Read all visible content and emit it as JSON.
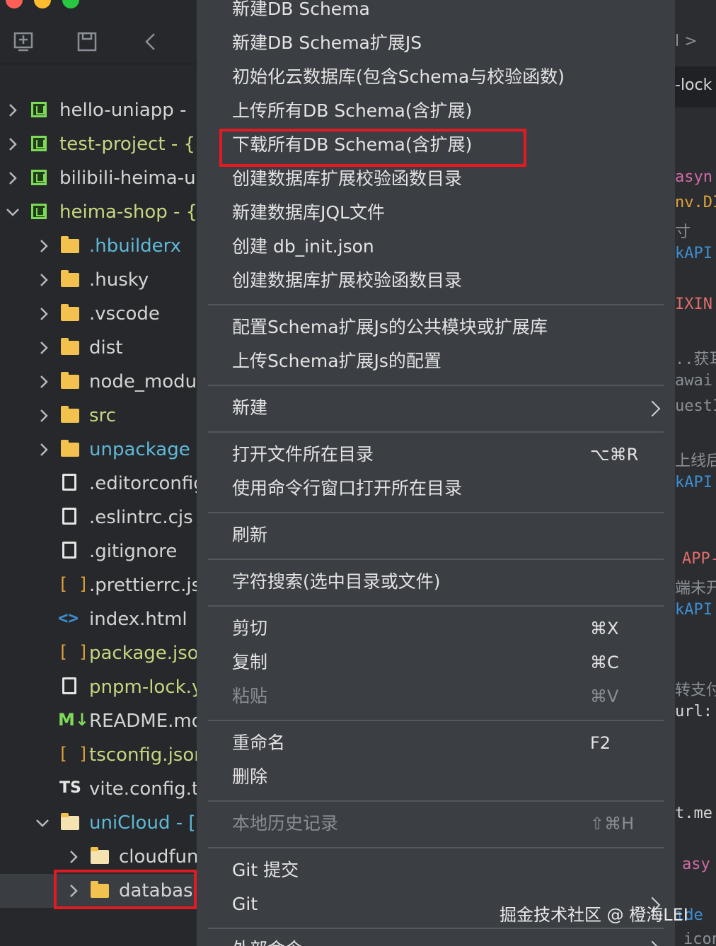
{
  "sidebar": {
    "tree": [
      {
        "label": "hello-uniapp - ",
        "type": "project"
      },
      {
        "label": "test-project - {",
        "type": "project"
      },
      {
        "label": "bilibili-heima-u",
        "type": "project"
      },
      {
        "label": "heima-shop - {",
        "type": "project"
      },
      {
        "label": ".hbuilderx",
        "type": "folder"
      },
      {
        "label": ".husky",
        "type": "folder"
      },
      {
        "label": ".vscode",
        "type": "folder"
      },
      {
        "label": "dist",
        "type": "folder"
      },
      {
        "label": "node_modul",
        "type": "folder"
      },
      {
        "label": "src",
        "type": "folder"
      },
      {
        "label": "unpackage",
        "type": "folder"
      },
      {
        "label": ".editorconfig",
        "type": "file"
      },
      {
        "label": ".eslintrc.cjs",
        "type": "file"
      },
      {
        "label": ".gitignore",
        "type": "file"
      },
      {
        "label": ".prettierrc.js",
        "type": "json"
      },
      {
        "label": "index.html",
        "type": "html"
      },
      {
        "label": "package.jso",
        "type": "json"
      },
      {
        "label": "pnpm-lock.y",
        "type": "file"
      },
      {
        "label": "README.md",
        "type": "markdown"
      },
      {
        "label": "tsconfig.json",
        "type": "json"
      },
      {
        "label": "vite.config.t",
        "type": "typescript"
      },
      {
        "label": "uniCloud - [",
        "type": "folder-open"
      },
      {
        "label": "cloudfun",
        "type": "folder"
      },
      {
        "label": "database",
        "type": "folder"
      }
    ],
    "icons": {
      "md": "M↓",
      "ts": "TS",
      "json": "[ ]",
      "html": "<>"
    }
  },
  "context_menu": {
    "groups": [
      [
        {
          "label": "新建DB Schema"
        },
        {
          "label": "新建DB Schema扩展JS"
        },
        {
          "label": "初始化云数据库(包含Schema与校验函数)"
        },
        {
          "label": "上传所有DB Schema(含扩展)"
        },
        {
          "label": "下载所有DB Schema(含扩展)",
          "highlighted": true
        },
        {
          "label": "创建数据库扩展校验函数目录"
        },
        {
          "label": "新建数据库JQL文件"
        },
        {
          "label": "创建 db_init.json"
        },
        {
          "label": "创建数据库扩展校验函数目录"
        }
      ],
      [
        {
          "label": "配置Schema扩展Js的公共模块或扩展库"
        },
        {
          "label": "上传Schema扩展Js的配置"
        }
      ],
      [
        {
          "label": "新建",
          "submenu": true
        }
      ],
      [
        {
          "label": "打开文件所在目录",
          "shortcut": "⌥⌘R"
        },
        {
          "label": "使用命令行窗口打开所在目录"
        }
      ],
      [
        {
          "label": "刷新"
        }
      ],
      [
        {
          "label": "字符搜索(选中目录或文件)"
        }
      ],
      [
        {
          "label": "剪切",
          "shortcut": "⌘X"
        },
        {
          "label": "复制",
          "shortcut": "⌘C"
        },
        {
          "label": "粘贴",
          "shortcut": "⌘V",
          "disabled": true
        }
      ],
      [
        {
          "label": "重命名",
          "shortcut": "F2"
        },
        {
          "label": "删除"
        }
      ],
      [
        {
          "label": "本地历史记录",
          "shortcut": "⇧⌘H",
          "disabled": true
        }
      ],
      [
        {
          "label": "Git 提交"
        },
        {
          "label": "Git",
          "submenu": true
        }
      ],
      [
        {
          "label": "外部命令",
          "submenu": true
        }
      ]
    ]
  },
  "editor_peek": {
    "tab_fragment": "-lock",
    "breadcrumb_fragment": "l >",
    "lines": [
      "asyn",
      "nv.DI",
      "寸",
      "kAPI",
      "IXIN",
      "..获耳",
      "awai",
      "uestI",
      "上线后",
      "kAPI",
      "APP-",
      "端未开",
      "kAPI",
      "转支付",
      "url:",
      "t.me",
      "asy",
      "ide",
      "icon"
    ]
  },
  "watermark": "掘金技术社区 @ 橙海LEI"
}
